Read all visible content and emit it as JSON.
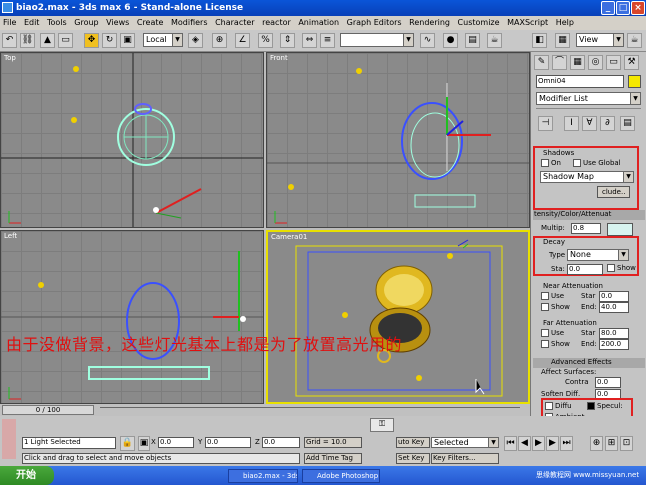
{
  "window": {
    "title": "biao2.max - 3ds max 6 - Stand-alone License",
    "buttons": [
      "_",
      "□",
      "×"
    ]
  },
  "menu": [
    "File",
    "Edit",
    "Tools",
    "Group",
    "Views",
    "Create",
    "Modifiers",
    "Character",
    "reactor",
    "Animation",
    "Graph Editors",
    "Rendering",
    "Customize",
    "MAXScript",
    "Help"
  ],
  "toolbar": {
    "refcoord": "Local",
    "named_sel": "",
    "view": "View"
  },
  "viewports": {
    "top": "Top",
    "front": "Front",
    "left": "Left",
    "camera": "Camera01"
  },
  "panel": {
    "object_name": "Omni04",
    "modifier_list": "Modifier List",
    "shadows": {
      "title": "Shadows",
      "on_label": "On",
      "use_global_label": "Use Global",
      "shadow_type": "Shadow Map",
      "exclude_label": "clude.."
    },
    "intensity": {
      "title": "tensity/Color/Attenuat",
      "multiplier_label": "Multip:",
      "multiplier_value": "0.8"
    },
    "decay": {
      "title": "Decay",
      "type_label": "Type",
      "type_value": "None",
      "start_label": "Sta:",
      "start_value": "0.0",
      "show_label": "Show"
    },
    "near": {
      "title": "Near Attenuation",
      "use": "Use",
      "show": "Show",
      "start_label": "Star",
      "end_label": "End:",
      "start_value": "0.0",
      "end_value": "40.0"
    },
    "far": {
      "title": "Far Attenuation",
      "use": "Use",
      "show": "Show",
      "start_label": "Star",
      "end_label": "End:",
      "start_value": "80.0",
      "end_value": "200.0"
    },
    "advanced": {
      "title": "Advanced Effects",
      "affect_title": "Affect Surfaces:",
      "contrast_label": "Contra",
      "contrast_value": "0.0",
      "soften_label": "Soften Diff.",
      "soften_value": "0.0",
      "diffuse_label": "Diffu",
      "specular_label": "Specul:",
      "ambient_label": "Ambient"
    }
  },
  "caption": "由于没做背景，这些灯光基本上都是为了放置高光用的",
  "timeline": {
    "frame": "0 / 100"
  },
  "status": {
    "selected": "1 Light Selected",
    "prompt": "Click and drag to select and move objects",
    "x_label": "X",
    "x_value": "0.0",
    "y_label": "Y",
    "y_value": "0.0",
    "z_label": "Z",
    "z_value": "0.0",
    "grid": "Grid = 10.0",
    "add_time_tag": "Add Time Tag",
    "auto_key": "uto Key",
    "selected_dropdown": "Selected",
    "set_key": "Set Key",
    "key_filters": "Key Filters..."
  },
  "taskbar": {
    "start": "开始",
    "tasks": [
      "biao2.max - 3ds ...",
      "Adobe Photoshop"
    ],
    "watermark": "思缘教程网 www.missyuan.net"
  }
}
